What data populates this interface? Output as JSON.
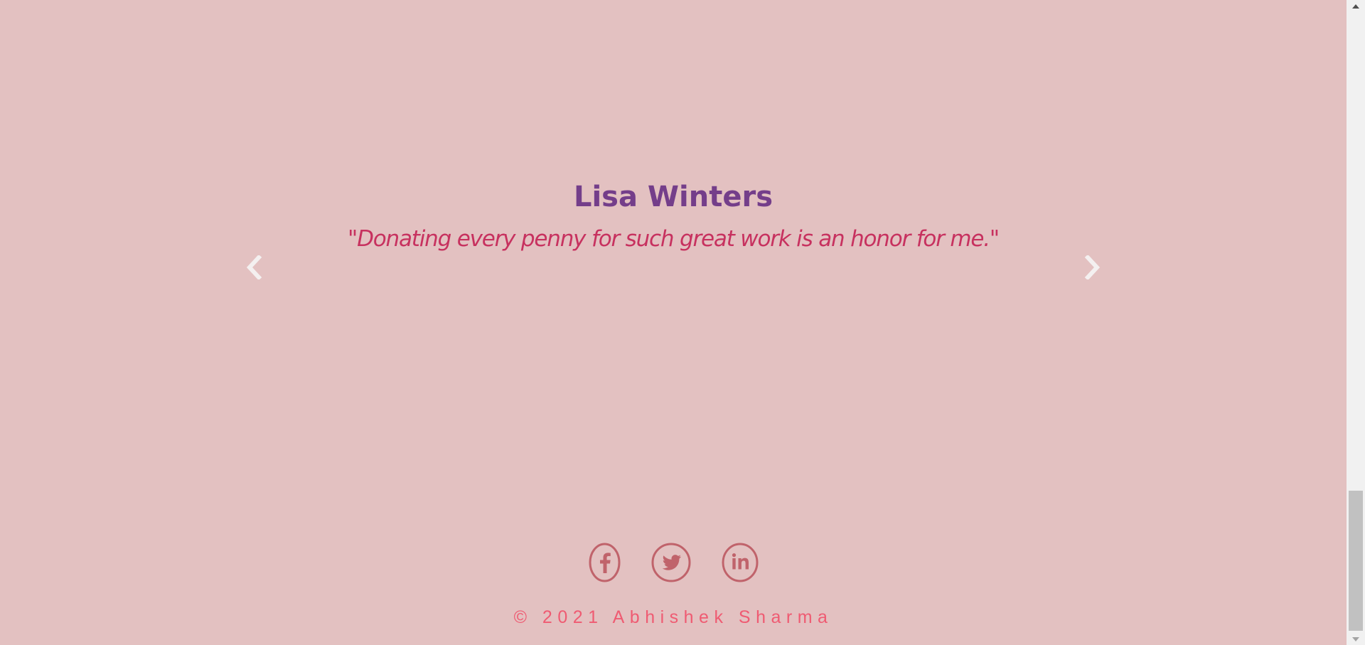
{
  "testimonial": {
    "name": "Lisa Winters",
    "quote": "\"Donating every penny for such great work is an honor for me.\"",
    "prev_icon": "chevron-left-icon",
    "next_icon": "chevron-right-icon"
  },
  "footer": {
    "social": [
      {
        "name": "facebook",
        "icon": "facebook-icon"
      },
      {
        "name": "twitter",
        "icon": "twitter-icon"
      },
      {
        "name": "linkedin",
        "icon": "linkedin-icon"
      }
    ],
    "copyright": "© 2021 Abhishek Sharma"
  },
  "colors": {
    "background": "#e3c1c1",
    "name": "#743e8a",
    "quote": "#c7315f",
    "social_icons": "#c0636b",
    "copyright": "#ef5b72",
    "arrows": "#f4f0f0"
  }
}
